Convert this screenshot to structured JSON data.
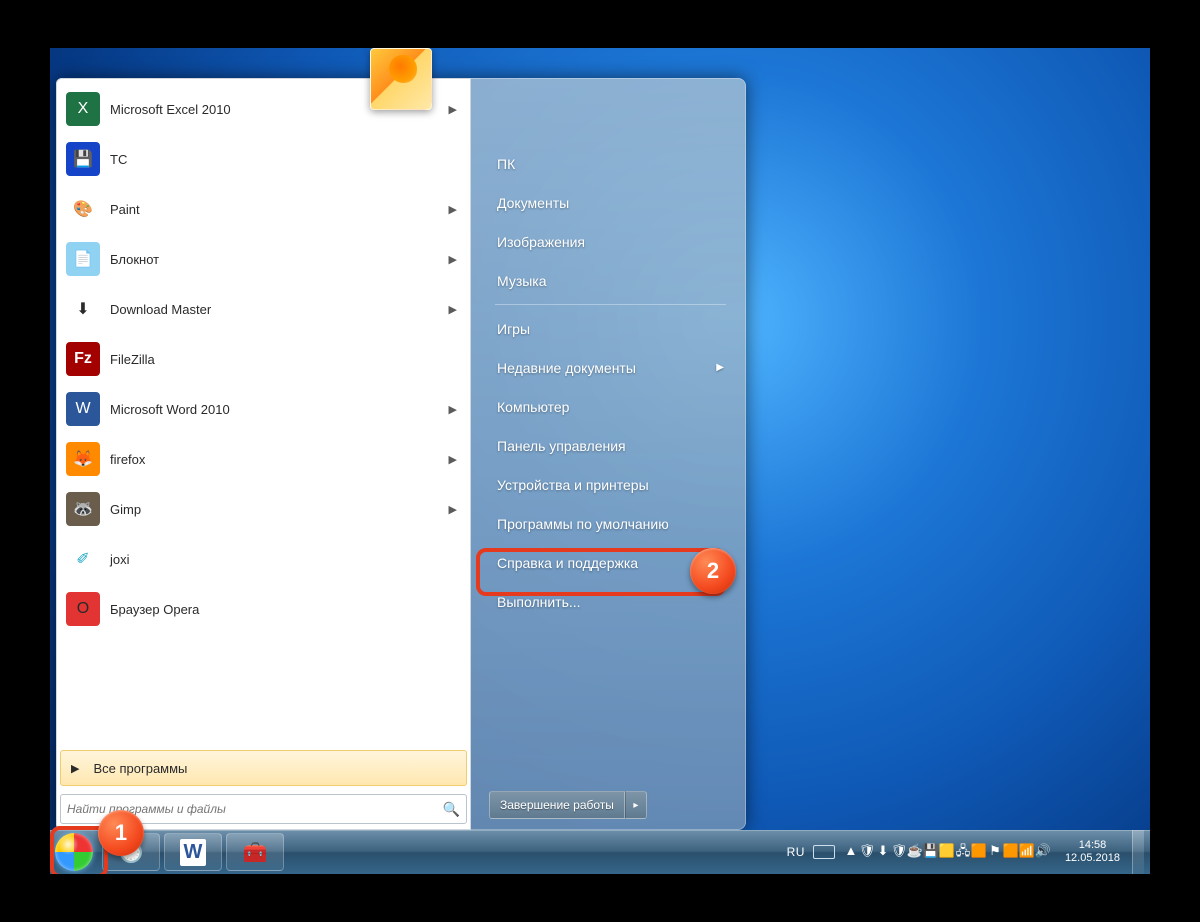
{
  "programs": [
    {
      "label": "Microsoft Excel 2010",
      "icon": "excel-icon",
      "cls": "ic-excel",
      "glyph": "X",
      "sub": true
    },
    {
      "label": "TC",
      "icon": "tc-icon",
      "cls": "ic-tc",
      "glyph": "💾",
      "sub": false
    },
    {
      "label": "Paint",
      "icon": "paint-icon",
      "cls": "ic-paint",
      "glyph": "🎨",
      "sub": true
    },
    {
      "label": "Блокнот",
      "icon": "notepad-icon",
      "cls": "ic-note",
      "glyph": "📄",
      "sub": true
    },
    {
      "label": "Download Master",
      "icon": "dm-icon",
      "cls": "ic-dm",
      "glyph": "⬇",
      "sub": true
    },
    {
      "label": "FileZilla",
      "icon": "filezilla-icon",
      "cls": "ic-fz",
      "glyph": "Fz",
      "sub": false
    },
    {
      "label": "Microsoft Word 2010",
      "icon": "word-icon",
      "cls": "ic-word",
      "glyph": "W",
      "sub": true
    },
    {
      "label": "firefox",
      "icon": "firefox-icon",
      "cls": "ic-ff",
      "glyph": "🦊",
      "sub": true
    },
    {
      "label": "Gimp",
      "icon": "gimp-icon",
      "cls": "ic-gimp",
      "glyph": "🦝",
      "sub": true
    },
    {
      "label": "joxi",
      "icon": "joxi-icon",
      "cls": "ic-joxi",
      "glyph": "✐",
      "sub": false
    },
    {
      "label": "Браузер Opera",
      "icon": "opera-icon",
      "cls": "ic-opera",
      "glyph": "O",
      "sub": false
    }
  ],
  "all_programs_label": "Все программы",
  "search_placeholder": "Найти программы и файлы",
  "right_items_top": [
    {
      "label": "ПК"
    },
    {
      "label": "Документы"
    },
    {
      "label": "Изображения"
    },
    {
      "label": "Музыка"
    }
  ],
  "right_items_mid": [
    {
      "label": "Игры"
    },
    {
      "label": "Недавние документы",
      "sub": true
    },
    {
      "label": "Компьютер"
    },
    {
      "label": "Панель управления"
    },
    {
      "label": "Устройства и принтеры"
    },
    {
      "label": "Программы по умолчанию"
    },
    {
      "label": "Справка и поддержка"
    },
    {
      "label": "Выполнить..."
    }
  ],
  "shutdown_label": "Завершение работы",
  "taskbar": {
    "lang": "RU",
    "time": "14:58",
    "date": "12.05.2018"
  },
  "annotations": {
    "badge1": "1",
    "badge2": "2"
  },
  "tray_icons": [
    "up-arrow-icon",
    "shield-icon",
    "jdownloader-icon",
    "uac-icon",
    "java-icon",
    "disk-icon",
    "defender-icon",
    "network-icon",
    "orange-icon",
    "flag-icon",
    "antivirus-icon",
    "wifi-icon",
    "volume-icon"
  ]
}
